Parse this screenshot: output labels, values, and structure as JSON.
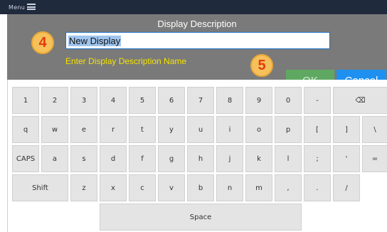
{
  "menu": {
    "label": "Menu"
  },
  "dialog": {
    "title": "Display Description",
    "input_value": "New Display",
    "hint": "Enter Display Description Name",
    "ok_label": "OK",
    "cancel_label": "Cancel"
  },
  "steps": {
    "four": "4",
    "five": "5"
  },
  "keyboard": {
    "row1": [
      "1",
      "2",
      "3",
      "4",
      "5",
      "6",
      "7",
      "8",
      "9",
      "0",
      "-",
      "⌫"
    ],
    "row2": [
      "q",
      "w",
      "e",
      "r",
      "t",
      "y",
      "u",
      "i",
      "o",
      "p",
      "[",
      "]",
      "\\"
    ],
    "row3": [
      "CAPS",
      "a",
      "s",
      "d",
      "f",
      "g",
      "h",
      "j",
      "k",
      "l",
      ";",
      "'",
      "="
    ],
    "row4": [
      "Shift",
      "z",
      "x",
      "c",
      "v",
      "b",
      "n",
      "m",
      ",",
      ".",
      "/"
    ],
    "space": "Space"
  },
  "colors": {
    "header_bg": "#7a7a7a",
    "hint_text": "#f5e300",
    "ok_button": "#5fa862",
    "cancel_button": "#1e90f0",
    "badge": "#f6c15a",
    "badge_number": "#e53a12"
  }
}
